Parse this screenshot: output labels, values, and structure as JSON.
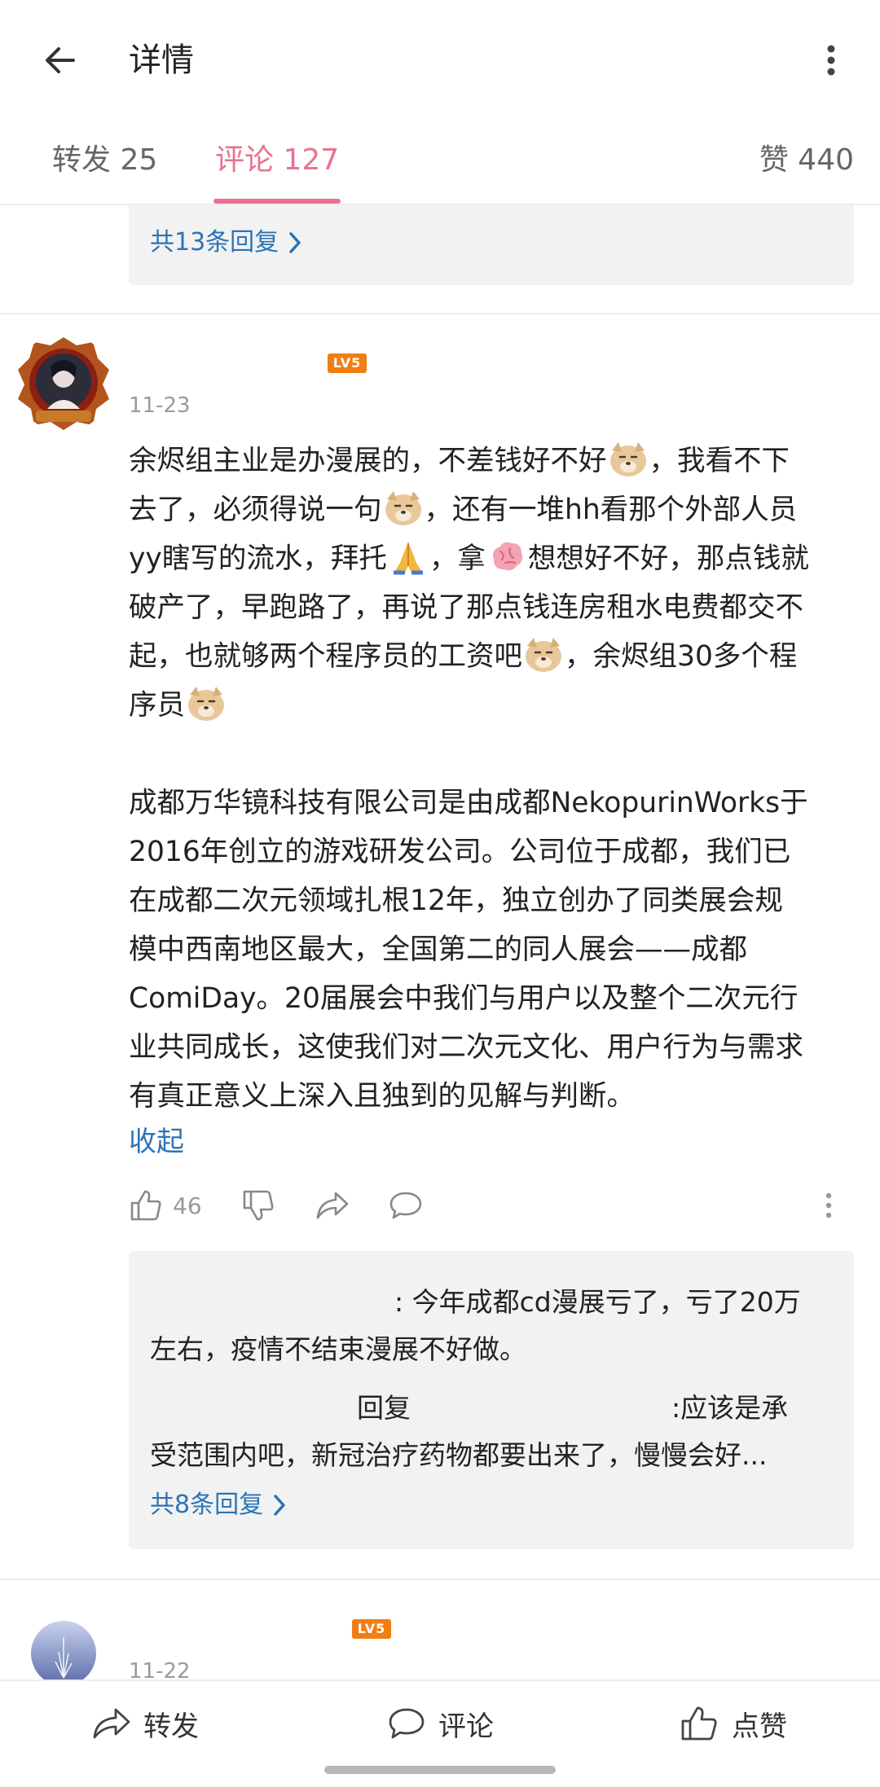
{
  "header": {
    "title": "详情",
    "back_icon": "arrow-left-icon",
    "more_icon": "more-vertical-icon"
  },
  "tabs": {
    "repost": "转发 25",
    "comments": "评论 127",
    "likes": "赞 440",
    "active_color": "#e9728e"
  },
  "previous_comment": {
    "reply_count_link": "共13条回复"
  },
  "comment": {
    "level_badge": "LV5",
    "date": "11-23",
    "text_lines": [
      "余烬组主业是办漫展的，不差钱好不好",
      "，我看不下",
      "去了，必须得说一句",
      "，还有一堆hh看那个外部人员",
      "yy瞎写的流水，拜托",
      "，拿",
      "想想好不好，那点钱就",
      "破产了，早跑路了，再说了那点钱连房租水电费都交不",
      "起，也就够两个程序员的工资吧",
      "，余烬组30多个程",
      "序员"
    ],
    "quote_lines": [
      "成都万华镜科技有限公司是由成都NekopurinWorks于",
      "2016年创立的游戏研发公司。公司位于成都，我们已",
      "在成都二次元领域扎根12年，独立创办了同类展会规",
      "模中西南地区最大，全国第二的同人展会——成都",
      "ComiDay。20届展会中我们与用户以及整个二次元行",
      "业共同成长，这使我们对二次元文化、用户行为与需求",
      "有真正意义上深入且独到的见解与判断。"
    ],
    "collapse_label": "收起",
    "like_count": "46",
    "link_color": "#2b74b5",
    "replies": {
      "first": ": 今年成都cd漫展亏了，亏了20万",
      "first_cont": "左右，疫情不结束漫展不好做。",
      "second_verb": "回复",
      "second": ":应该是承",
      "second_cont": "受范围内吧，新冠治疗药物都要出来了，慢慢会好...",
      "more_link": "共8条回复"
    }
  },
  "next_comment": {
    "level_badge": "LV5",
    "date": "11-22"
  },
  "bottom_bar": {
    "repost": "转发",
    "comment": "评论",
    "like": "点赞"
  }
}
